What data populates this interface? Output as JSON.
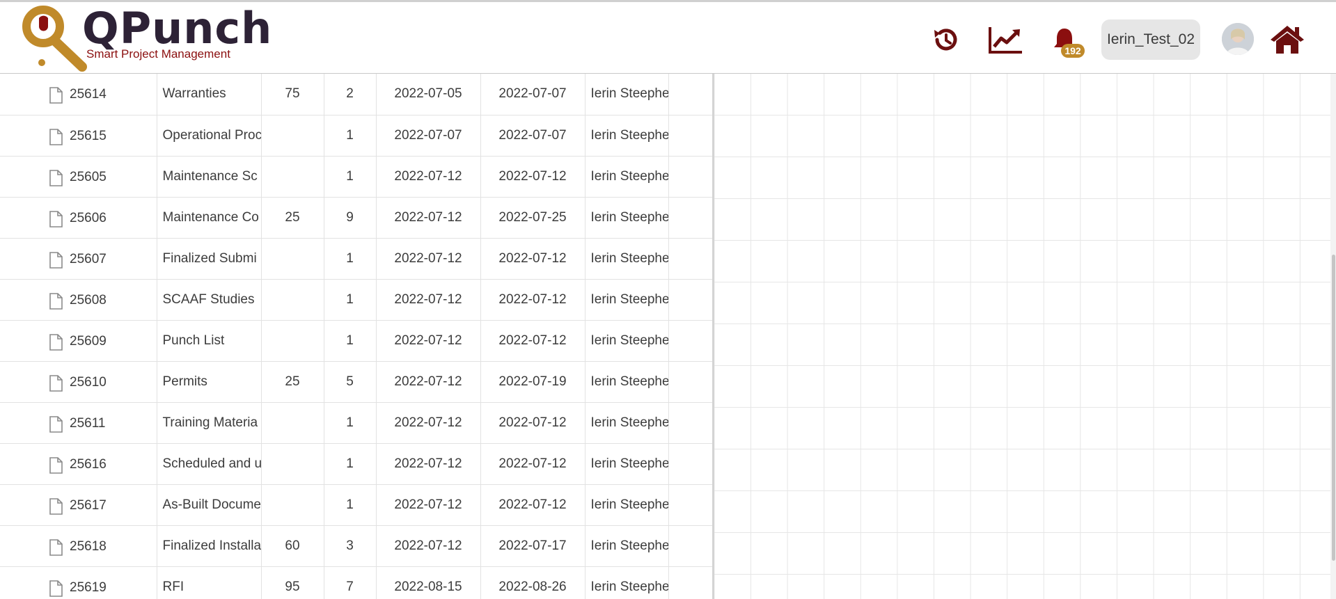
{
  "app": {
    "logo_name": "QPunch",
    "logo_tagline": "Smart Project Management"
  },
  "header": {
    "icons": [
      "history-icon",
      "chart-trend-icon",
      "bell-icon",
      "home-icon"
    ],
    "notification_count": "192",
    "user_name": "Ierin_Test_02"
  },
  "colors": {
    "brand_dark": "#6b0f0f",
    "accent_gold": "#c08a2a",
    "logo_text": "#2d2236"
  },
  "tasks": {
    "rows": [
      {
        "id": "25614",
        "name": "Warranties",
        "work": "75",
        "duration": "2",
        "start": "2022-07-05",
        "end": "2022-07-07",
        "owner": "Ierin Steephe"
      },
      {
        "id": "25615",
        "name": "Operational Proc",
        "work": "",
        "duration": "1",
        "start": "2022-07-07",
        "end": "2022-07-07",
        "owner": "Ierin Steephe"
      },
      {
        "id": "25605",
        "name": "Maintenance Sc",
        "work": "",
        "duration": "1",
        "start": "2022-07-12",
        "end": "2022-07-12",
        "owner": "Ierin Steephe"
      },
      {
        "id": "25606",
        "name": "Maintenance Co",
        "work": "25",
        "duration": "9",
        "start": "2022-07-12",
        "end": "2022-07-25",
        "owner": "Ierin Steephe"
      },
      {
        "id": "25607",
        "name": "Finalized Submi",
        "work": "",
        "duration": "1",
        "start": "2022-07-12",
        "end": "2022-07-12",
        "owner": "Ierin Steephe"
      },
      {
        "id": "25608",
        "name": "SCAAF Studies",
        "work": "",
        "duration": "1",
        "start": "2022-07-12",
        "end": "2022-07-12",
        "owner": "Ierin Steephe"
      },
      {
        "id": "25609",
        "name": "Punch List",
        "work": "",
        "duration": "1",
        "start": "2022-07-12",
        "end": "2022-07-12",
        "owner": "Ierin Steephe"
      },
      {
        "id": "25610",
        "name": "Permits",
        "work": "25",
        "duration": "5",
        "start": "2022-07-12",
        "end": "2022-07-19",
        "owner": "Ierin Steephe"
      },
      {
        "id": "25611",
        "name": "Training Materia",
        "work": "",
        "duration": "1",
        "start": "2022-07-12",
        "end": "2022-07-12",
        "owner": "Ierin Steephe"
      },
      {
        "id": "25616",
        "name": "Scheduled and u",
        "work": "",
        "duration": "1",
        "start": "2022-07-12",
        "end": "2022-07-12",
        "owner": "Ierin Steephe"
      },
      {
        "id": "25617",
        "name": "As-Built Docume",
        "work": "",
        "duration": "1",
        "start": "2022-07-12",
        "end": "2022-07-12",
        "owner": "Ierin Steephe"
      },
      {
        "id": "25618",
        "name": "Finalized Installa",
        "work": "60",
        "duration": "3",
        "start": "2022-07-12",
        "end": "2022-07-17",
        "owner": "Ierin Steephe"
      },
      {
        "id": "25619",
        "name": "RFI",
        "work": "95",
        "duration": "7",
        "start": "2022-08-15",
        "end": "2022-08-26",
        "owner": "Ierin Steephe"
      }
    ]
  }
}
